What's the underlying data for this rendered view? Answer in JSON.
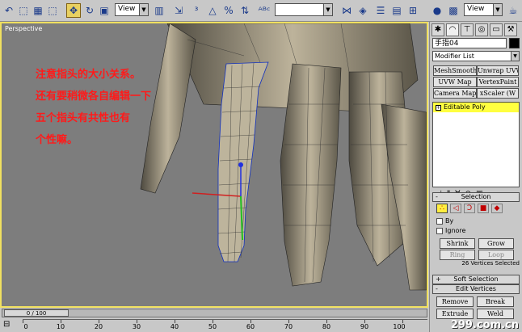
{
  "toolbar": {
    "view_select_left": "View",
    "view_select_right": "View",
    "named_selection": ""
  },
  "viewport": {
    "label": "Perspective",
    "annotation_lines": [
      "注意指头的大小关系。",
      "还有要稍微各自编辑一下",
      "五个指头有共性也有",
      "个性嘛。"
    ]
  },
  "panel": {
    "object_name": "手指04",
    "modifier_list": "Modifier List",
    "modifier_buttons": [
      "MeshSmooth",
      "Unwrap UVW",
      "UVW Map",
      "VertexPaint",
      "Camera Map",
      "xScaler (W"
    ],
    "stack_item": "Editable Poly",
    "selection_title": "Selection",
    "by_label": "By",
    "ignore_label": "Ignore",
    "shrink": "Shrink",
    "grow": "Grow",
    "ring": "Ring",
    "loop": "Loop",
    "selected_status": "26 Vertices Selected",
    "soft_selection_title": "Soft Selection",
    "edit_vertices_title": "Edit Vertices",
    "remove": "Remove",
    "break": "Break",
    "extrude": "Extrude",
    "weld": "Weld"
  },
  "timeline": {
    "frame_display": "0 / 100",
    "ticks": [
      "0",
      "10",
      "20",
      "30",
      "40",
      "50",
      "60",
      "70",
      "80",
      "90",
      "100"
    ]
  },
  "watermark": "299.com.cn"
}
